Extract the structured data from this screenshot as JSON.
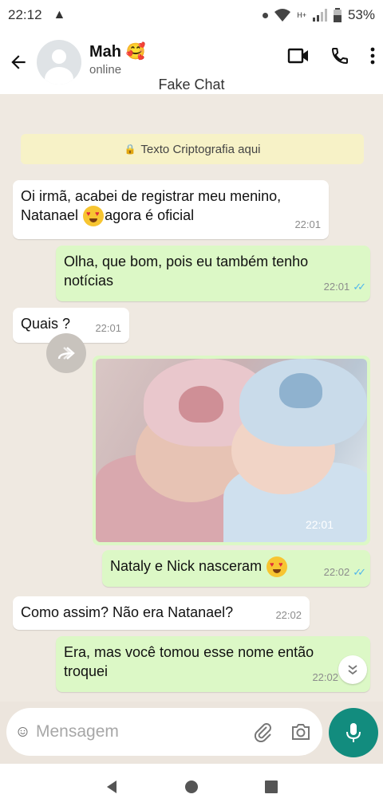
{
  "status_bar": {
    "time": "22:12",
    "battery": "53%",
    "network": "H+"
  },
  "header": {
    "contact_name": "Mah 🥰",
    "presence": "online",
    "app_label": "Fake Chat"
  },
  "encryption_notice": "Texto Criptografia aqui",
  "messages": [
    {
      "dir": "in",
      "line1": "Oi irmã, acabei de registrar meu menino,",
      "line2a": "Natanael ",
      "line2b": "agora é oficial",
      "time": "22:01"
    },
    {
      "dir": "out",
      "line1": "Olha, que bom, pois eu também tenho",
      "line2": "notícias",
      "time": "22:01"
    },
    {
      "dir": "in",
      "text": "Quais ?",
      "time": "22:01"
    },
    {
      "dir": "out",
      "kind": "image",
      "time": "22:01"
    },
    {
      "dir": "out",
      "text": "Nataly e Nick nasceram ",
      "time": "22:02"
    },
    {
      "dir": "in",
      "text": "Como assim? Não era Natanael?",
      "time": "22:02"
    },
    {
      "dir": "out",
      "line1": "Era, mas você tomou esse nome então",
      "line2": "troquei",
      "time": "22:02"
    }
  ],
  "composer": {
    "placeholder": "Mensagem"
  },
  "icons": {
    "back": "arrow-left",
    "video": "video-camera",
    "call": "phone",
    "menu": "more-vertical",
    "emoji": "smiley",
    "attach": "paperclip",
    "camera": "camera",
    "mic": "microphone",
    "forward": "forward-arrow",
    "scroll": "double-chevron-down"
  },
  "colors": {
    "outgoing": "#dcf8c6",
    "incoming": "#ffffff",
    "accent": "#128c7e",
    "ticks": "#4fb6ec"
  }
}
